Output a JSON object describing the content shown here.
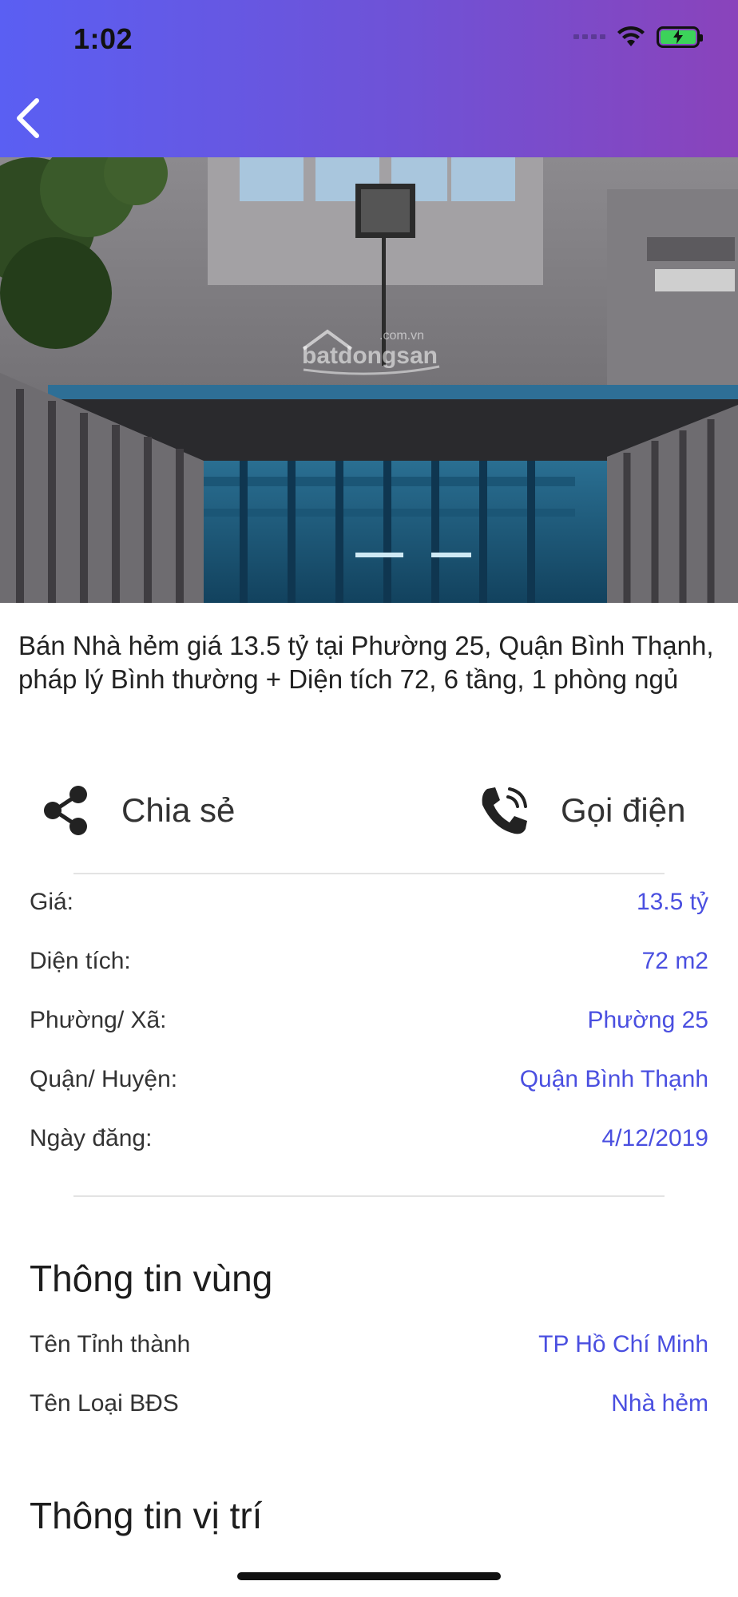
{
  "status_bar": {
    "time": "1:02"
  },
  "header": {
    "back_icon": "chevron-left-icon",
    "gradient_start": "#5a5ff3",
    "gradient_end": "#8a43bb"
  },
  "hero": {
    "watermark_sub": ".com.vn",
    "watermark_main": "batdongsan"
  },
  "listing": {
    "title": "Bán Nhà hẻm giá 13.5 tỷ tại Phường 25, Quận Bình Thạnh, pháp lý Bình thường + Diện tích 72, 6 tầng, 1 phòng ngủ"
  },
  "actions": {
    "share_label": "Chia sẻ",
    "share_icon": "share-icon",
    "call_label": "Gọi điện",
    "call_icon": "phone-icon"
  },
  "details": [
    {
      "label": "Giá:",
      "value": "13.5 tỷ"
    },
    {
      "label": "Diện tích:",
      "value": "72 m2"
    },
    {
      "label": "Phường/ Xã:",
      "value": "Phường 25"
    },
    {
      "label": "Quận/ Huyện:",
      "value": "Quận Bình Thạnh"
    },
    {
      "label": "Ngày đăng:",
      "value": "4/12/2019"
    }
  ],
  "region": {
    "title": "Thông tin vùng",
    "rows": [
      {
        "label": "Tên Tỉnh thành",
        "value": "TP Hồ Chí Minh"
      },
      {
        "label": "Tên Loại BĐS",
        "value": "Nhà hẻm"
      }
    ]
  },
  "location": {
    "title": "Thông tin vị trí"
  },
  "colors": {
    "accent": "#4a4fe0",
    "text": "#222222"
  }
}
